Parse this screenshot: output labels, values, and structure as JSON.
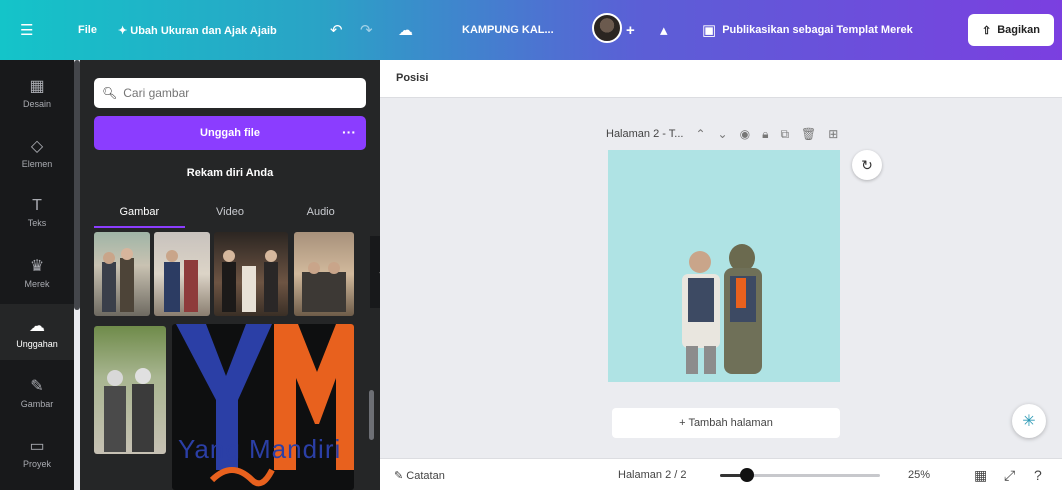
{
  "topbar": {
    "menu_icon": "hamburger-icon",
    "file_label": "File",
    "resize_label": "✦ Ubah Ukuran dan Ajak Ajaib",
    "undo_icon": "undo-icon",
    "redo_icon": "redo-icon",
    "cloud_icon": "cloud-saved-icon",
    "doc_title": "KAMPUNG KAL...",
    "add_collab": "+",
    "analytics_icon": "chart-icon",
    "publish_label": "Publikasikan sebagai Templat Merek",
    "share_label": "Bagikan"
  },
  "rail": {
    "items": [
      {
        "label": "Desain",
        "icon": "layout-icon"
      },
      {
        "label": "Elemen",
        "icon": "shapes-icon"
      },
      {
        "label": "Teks",
        "icon": "text-icon"
      },
      {
        "label": "Merek",
        "icon": "brand-icon"
      },
      {
        "label": "Unggahan",
        "icon": "cloud-upload-icon"
      },
      {
        "label": "Gambar",
        "icon": "draw-icon"
      },
      {
        "label": "Proyek",
        "icon": "folder-icon"
      }
    ],
    "active_index": 4
  },
  "panel": {
    "search_placeholder": "Cari gambar",
    "upload_label": "Unggah file",
    "upload_more": "···",
    "record_label": "Rekam diri Anda",
    "tabs": [
      "Gambar",
      "Video",
      "Audio"
    ],
    "active_tab": 0,
    "logo_text": "YM",
    "logo_subtext": "Yang Mandiri"
  },
  "editor": {
    "position_label": "Posisi",
    "page_title": "Halaman 2 - T...",
    "add_page_label": "+ Tambah halaman",
    "assist_icon": "magic-assist-icon"
  },
  "footer": {
    "notes_label": "Catatan",
    "page_counter": "Halaman 2 / 2",
    "zoom_value": 0.25,
    "zoom_label": "25%"
  },
  "colors": {
    "accent": "#8b3dff",
    "canvas": "#afe3e4",
    "panel_bg": "#252627",
    "rail_bg": "#18191b"
  }
}
